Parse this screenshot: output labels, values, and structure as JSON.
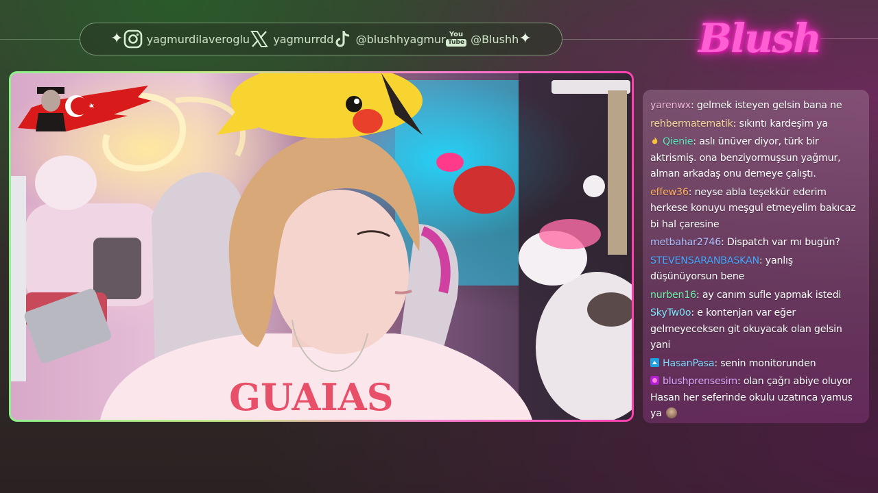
{
  "social": {
    "instagram": "yagmurdilaveroglu",
    "x": "yagmurrdd",
    "tiktok": "@blushhyagmur",
    "youtube_badge_top": "You",
    "youtube_badge_bottom": "Tube",
    "youtube": "@Blushh"
  },
  "logo": {
    "text": "Blush",
    "color": "#ff5fd2"
  },
  "colors": {
    "frame_green": "#8ff08a",
    "frame_pink": "#ff3fae"
  },
  "icons": [
    "sparkle-icon",
    "instagram-icon",
    "x-icon",
    "tiktok-icon",
    "youtube-icon",
    "turkey-flag-icon"
  ],
  "chat": {
    "messages": [
      {
        "user": "yarenwx",
        "color": "#f0b8d8",
        "badge": "",
        "text": ": gelmek isteyen gelsin bana ne"
      },
      {
        "user": "rehbermatematik",
        "color": "#f6d79a",
        "badge": "",
        "text": ": sıkıntı kardeşim ya"
      },
      {
        "user": "Qienie",
        "color": "#5ee8c0",
        "badge": "flame",
        "text": ": aslı ünüver diyor, türk bir aktrismiş. ona benziyormuşsun yağmur, alman arkadaş onu demeye çalıştı."
      },
      {
        "user": "effew36",
        "color": "#ffb060",
        "badge": "",
        "text": ": neyse abla teşekkür ederim herkese konuyu meşgul etmeyelim bakıcaz bi hal çaresine"
      },
      {
        "user": "metbahar2746",
        "color": "#b0c0ff",
        "badge": "",
        "text": ": Dispatch var mı bugün?"
      },
      {
        "user": "STEVENSARANBASKAN",
        "color": "#4aa8ff",
        "badge": "",
        "text": ": yanlış düşünüyorsun bene"
      },
      {
        "user": "nurben16",
        "color": "#6ef0a8",
        "badge": "",
        "text": ": ay canım sufle yapmak istedi"
      },
      {
        "user": "SkyTw0o",
        "color": "#7ee8ff",
        "badge": "",
        "text": ": e kontenjan var eğer gelmeyeceksen git okuyacak olan gelsin yani"
      },
      {
        "user": "HasanPasa",
        "color": "#7ed8ff",
        "badge": "prime",
        "text": ": senin monitorunden"
      },
      {
        "user": "blushprensesim",
        "color": "#e0a8ff",
        "badge": "sub",
        "text": ": olan çağrı abiye oluyor Hasan her seferinde okulu uzatınca yamus ya"
      }
    ]
  }
}
